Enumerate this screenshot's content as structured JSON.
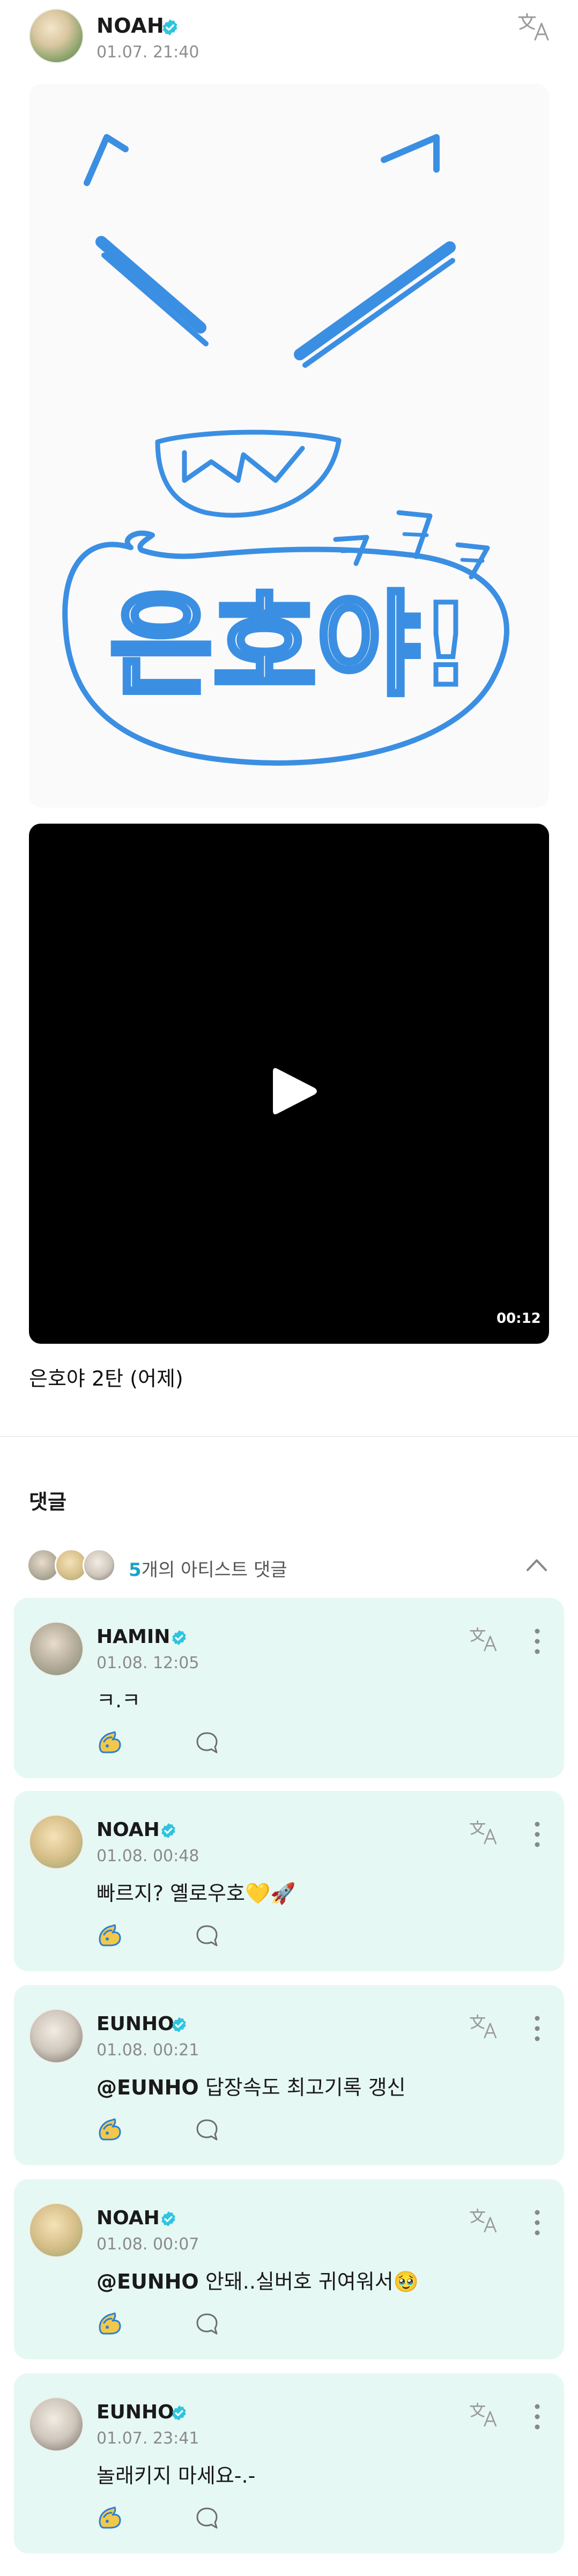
{
  "post": {
    "author": "NOAH",
    "date": "01.07. 21:40",
    "caption": "은호야 2탄 (어제)",
    "drawing_text": "은호야!",
    "drawing_laugh": "ㅋㅋㅋ",
    "video_duration": "00:12"
  },
  "comments_section": {
    "title": "댓글",
    "artist_count": "5",
    "artist_label": "개의 아티스트 댓글"
  },
  "comments": [
    {
      "author": "HAMIN",
      "date": "01.08. 12:05",
      "mention": "",
      "text": "ㅋ.ㅋ"
    },
    {
      "author": "NOAH",
      "date": "01.08. 00:48",
      "mention": "",
      "text": "빠르지? 옐로우호💛🚀"
    },
    {
      "author": "EUNHO",
      "date": "01.08. 00:21",
      "mention": "@EUNHO",
      "text": " 답장속도 최고기록 갱신"
    },
    {
      "author": "NOAH",
      "date": "01.08. 00:07",
      "mention": "@EUNHO",
      "text": " 안돼..실버호 귀여워서🥹"
    },
    {
      "author": "EUNHO",
      "date": "01.07. 23:41",
      "mention": "",
      "text": "놀래키지 마세요-.-"
    }
  ],
  "colors": {
    "accent": "#1aa3c9",
    "verified": "#2ec4e0",
    "comment_bg": "#e6f8f3",
    "drawing_stroke": "#3b8fe3"
  },
  "icons": [
    "verified-icon",
    "translate-icon",
    "play-icon",
    "chevron-up-icon",
    "more-icon",
    "like-icon",
    "reply-icon"
  ]
}
